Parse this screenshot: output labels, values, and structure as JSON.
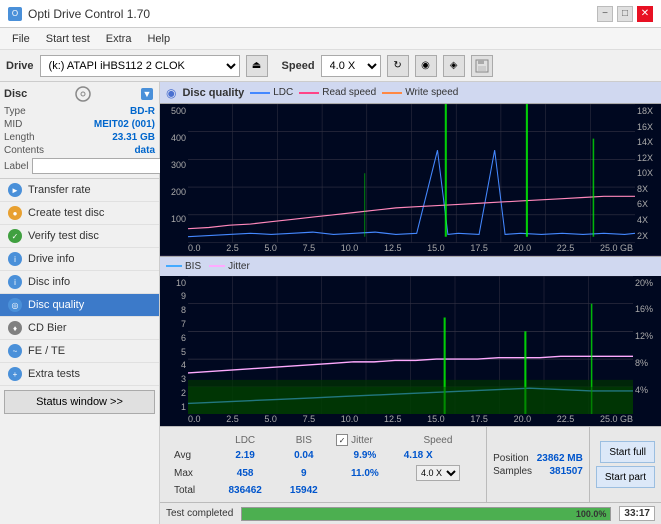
{
  "titlebar": {
    "title": "Opti Drive Control 1.70",
    "min": "−",
    "max": "□",
    "close": "✕"
  },
  "menubar": {
    "items": [
      "File",
      "Start test",
      "Extra",
      "Help"
    ]
  },
  "toolbar": {
    "drive_label": "Drive",
    "drive_value": "(k:) ATAPI iHBS112  2 CLOK",
    "speed_label": "Speed",
    "speed_value": "4.0 X"
  },
  "disc_section": {
    "title": "Disc",
    "type_label": "Type",
    "type_value": "BD-R",
    "mid_label": "MID",
    "mid_value": "MEIT02 (001)",
    "length_label": "Length",
    "length_value": "23.31 GB",
    "contents_label": "Contents",
    "contents_value": "data",
    "label_label": "Label"
  },
  "nav_items": [
    {
      "id": "transfer-rate",
      "label": "Transfer rate",
      "icon": "►",
      "color": "blue"
    },
    {
      "id": "create-test-disc",
      "label": "Create test disc",
      "icon": "●",
      "color": "orange"
    },
    {
      "id": "verify-test-disc",
      "label": "Verify test disc",
      "icon": "✓",
      "color": "green"
    },
    {
      "id": "drive-info",
      "label": "Drive info",
      "icon": "i",
      "color": "blue"
    },
    {
      "id": "disc-info",
      "label": "Disc info",
      "icon": "i",
      "color": "blue"
    },
    {
      "id": "disc-quality",
      "label": "Disc quality",
      "icon": "◎",
      "color": "blue",
      "active": true
    },
    {
      "id": "cd-bier",
      "label": "CD Bier",
      "icon": "♦",
      "color": "gray"
    },
    {
      "id": "fe-te",
      "label": "FE / TE",
      "icon": "~",
      "color": "blue"
    },
    {
      "id": "extra-tests",
      "label": "Extra tests",
      "icon": "+",
      "color": "blue"
    }
  ],
  "status_button": "Status window >>",
  "chart": {
    "title": "Disc quality",
    "legend": [
      {
        "id": "ldc",
        "label": "LDC",
        "color": "#4488ff"
      },
      {
        "id": "read-speed",
        "label": "Read speed",
        "color": "#ff4488"
      },
      {
        "id": "write-speed",
        "label": "Write speed",
        "color": "#ff8844"
      }
    ],
    "legend2": [
      {
        "id": "bis",
        "label": "BIS",
        "color": "#44aaff"
      },
      {
        "id": "jitter",
        "label": "Jitter",
        "color": "#ffaaff"
      }
    ],
    "top_yaxis": [
      500,
      400,
      300,
      200,
      100
    ],
    "top_yaxis_right": [
      "18X",
      "16X",
      "14X",
      "12X",
      "10X",
      "8X",
      "6X",
      "4X",
      "2X"
    ],
    "bottom_yaxis": [
      10,
      9,
      8,
      7,
      6,
      5,
      4,
      3,
      2,
      1
    ],
    "bottom_yaxis_right": [
      "20%",
      "16%",
      "12%",
      "8%",
      "4%"
    ],
    "xaxis": [
      0.0,
      2.5,
      5.0,
      7.5,
      10.0,
      12.5,
      15.0,
      17.5,
      20.0,
      22.5
    ],
    "xaxis_label": "25.0 GB"
  },
  "stats": {
    "columns": [
      "LDC",
      "BIS",
      "",
      "Jitter",
      "Speed"
    ],
    "avg_label": "Avg",
    "avg_ldc": "2.19",
    "avg_bis": "0.04",
    "avg_jitter": "9.9%",
    "avg_speed": "4.18 X",
    "avg_speed_set": "4.0 X",
    "max_label": "Max",
    "max_ldc": "458",
    "max_bis": "9",
    "max_jitter": "11.0%",
    "total_label": "Total",
    "total_ldc": "836462",
    "total_bis": "15942",
    "position_label": "Position",
    "position_value": "23862 MB",
    "samples_label": "Samples",
    "samples_value": "381507",
    "start_full": "Start full",
    "start_part": "Start part"
  },
  "statusbar": {
    "text": "Test completed",
    "progress": "100.0%",
    "time": "33:17"
  }
}
